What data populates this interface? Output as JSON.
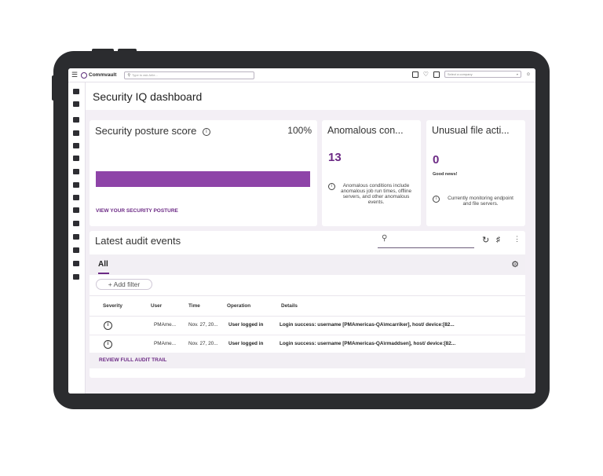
{
  "app": {
    "brand": "Commvault",
    "search_placeholder": "Type to ask Arlie...",
    "company_placeholder": "Select a company"
  },
  "header": {
    "title": "Security IQ dashboard"
  },
  "posture": {
    "title": "Security posture score",
    "percent": "100%",
    "link": "VIEW YOUR SECURITY POSTURE",
    "bar_fill": 1.0
  },
  "anomalous": {
    "title": "Anomalous con...",
    "count": "13",
    "note": "Anomalous conditions include anomalous job run times, offline servers, and other anomalous events."
  },
  "unusual": {
    "title": "Unusual file acti...",
    "count": "0",
    "status": "Good news!",
    "note": "Currently monitoring endpoint and file servers."
  },
  "audit": {
    "title": "Latest audit events",
    "tab": "All",
    "add_filter": "+ Add filter",
    "columns": [
      "Severity",
      "User",
      "Time",
      "Operation",
      "Details"
    ],
    "rows": [
      {
        "user": "PMAme...",
        "time": "Nov. 27, 20...",
        "operation": "User logged in",
        "details": "Login success: username [PMAmericas-QA\\mcarriker], host/ device:[82..."
      },
      {
        "user": "PMAme...",
        "time": "Nov. 27, 20...",
        "operation": "User logged in",
        "details": "Login success: username [PMAmericas-QA\\rmaddsen], host/ device:[82..."
      }
    ],
    "footer_link": "REVIEW FULL AUDIT TRAIL"
  },
  "colors": {
    "accent": "#6c2a85",
    "bar": "#8e44a8",
    "page_bg": "#f3eff5",
    "frame": "#2b2c2f"
  },
  "icons": {
    "menu": "hamburger-icon",
    "search": "search-icon",
    "bell": "bell-icon",
    "refresh": "refresh-icon",
    "columns": "columns-icon",
    "gear": "gear-icon",
    "info": "info-icon"
  }
}
